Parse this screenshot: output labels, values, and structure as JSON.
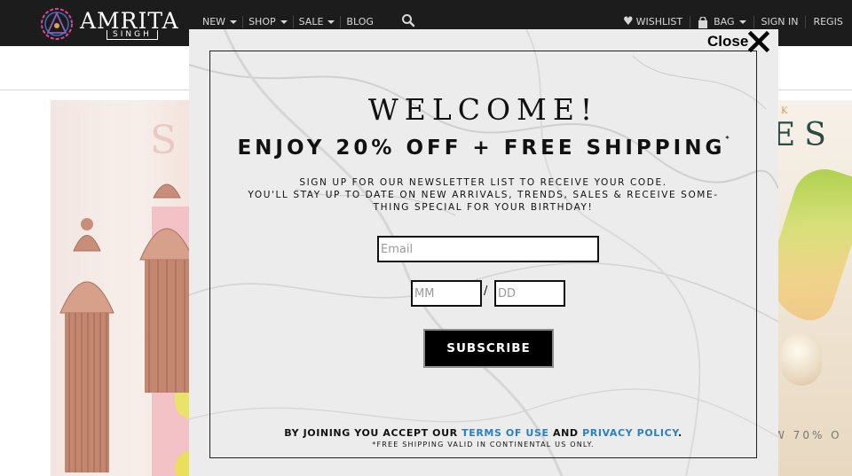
{
  "brand": {
    "name": "AMRITA",
    "sub": "SINGH"
  },
  "nav": {
    "items": [
      {
        "label": "NEW",
        "dropdown": true
      },
      {
        "label": "SHOP",
        "dropdown": true
      },
      {
        "label": "SALE",
        "dropdown": true
      },
      {
        "label": "BLOG",
        "dropdown": false
      }
    ],
    "search_icon": "search-icon"
  },
  "account_nav": {
    "wishlist": "WISHLIST",
    "bag": "BAG",
    "sign_in": "SIGN IN",
    "register": "REGIS"
  },
  "background": {
    "left_banner_letter": "S",
    "right_banner_small": "K",
    "right_banner_title": "ES",
    "right_banner_offer": "W 70% O"
  },
  "modal": {
    "close_label": "Close",
    "heading": "WELCOME!",
    "offer": "ENJOY 20% OFF + FREE SHIPPING",
    "offer_mark": "*",
    "description_lines": [
      "SIGN UP FOR OUR NEWSLETTER LIST TO RECEIVE YOUR CODE.",
      "YOU'LL STAY UP TO DATE ON NEW ARRIVALS, TRENDS, SALES & RECEIVE SOME-",
      "THING SPECIAL FOR YOUR BIRTHDAY!"
    ],
    "email_placeholder": "Email",
    "month_placeholder": "MM",
    "day_placeholder": "DD",
    "date_separator": "/",
    "subscribe_label": "SUBSCRIBE",
    "legal": {
      "prefix": "BY JOINING YOU ACCEPT OUR ",
      "terms": "TERMS OF USE",
      "and": " AND ",
      "privacy": "PRIVACY POLICY",
      "suffix": "."
    },
    "fine_print": "*FREE SHIPPING VALID IN CONTINENTAL US ONLY."
  },
  "colors": {
    "topbar": "#1c1c1c",
    "link": "#2a7fc1",
    "button": "#000000"
  }
}
